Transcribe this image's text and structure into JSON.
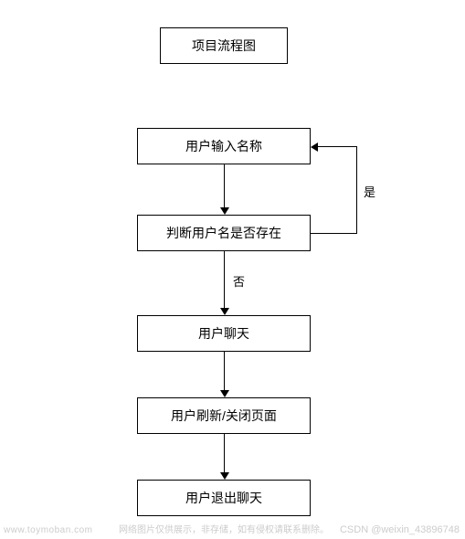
{
  "title": "项目流程图",
  "nodes": {
    "input_name": "用户输入名称",
    "check_user": "判断用户名是否存在",
    "chat": "用户聊天",
    "refresh": "用户刷新/关闭页面",
    "exit": "用户退出聊天"
  },
  "labels": {
    "yes": "是",
    "no": "否"
  },
  "watermark": {
    "left": "www.toymoban.com",
    "mid": "网络图片仅供展示，非存储，如有侵权请联系删除。",
    "right": "CSDN @weixin_43896748"
  },
  "chart_data": {
    "type": "flowchart",
    "title": "项目流程图",
    "nodes": [
      {
        "id": "title",
        "label": "项目流程图",
        "kind": "title"
      },
      {
        "id": "input_name",
        "label": "用户输入名称",
        "kind": "process"
      },
      {
        "id": "check_user",
        "label": "判断用户名是否存在",
        "kind": "decision"
      },
      {
        "id": "chat",
        "label": "用户聊天",
        "kind": "process"
      },
      {
        "id": "refresh",
        "label": "用户刷新/关闭页面",
        "kind": "process"
      },
      {
        "id": "exit",
        "label": "用户退出聊天",
        "kind": "process"
      }
    ],
    "edges": [
      {
        "from": "input_name",
        "to": "check_user",
        "label": ""
      },
      {
        "from": "check_user",
        "to": "input_name",
        "label": "是"
      },
      {
        "from": "check_user",
        "to": "chat",
        "label": "否"
      },
      {
        "from": "chat",
        "to": "refresh",
        "label": ""
      },
      {
        "from": "refresh",
        "to": "exit",
        "label": ""
      }
    ]
  }
}
